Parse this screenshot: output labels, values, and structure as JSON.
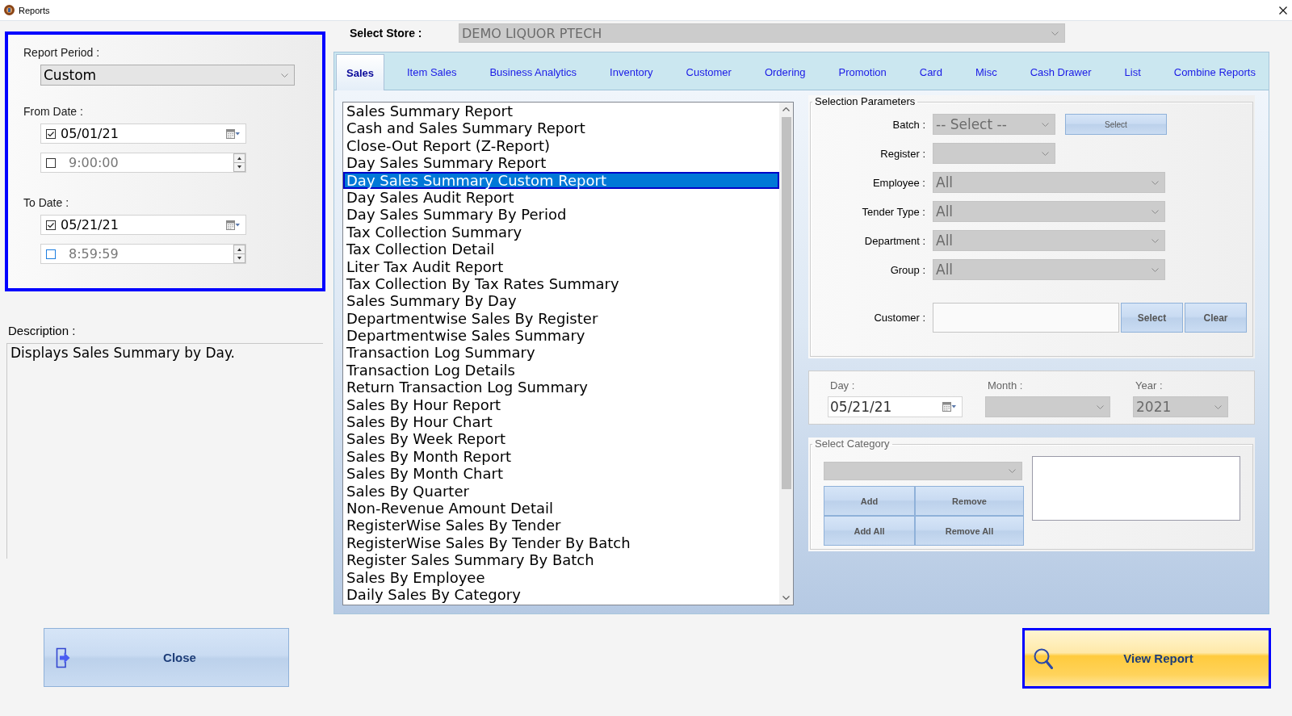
{
  "window": {
    "title": "Reports"
  },
  "period": {
    "label": "Report Period :",
    "dropdown": {
      "value": "Custom",
      "disabled": false
    },
    "ranges": [
      {
        "label": "From Date :",
        "date": {
          "value": "05/01/21",
          "checked": true,
          "focused": false
        },
        "time": {
          "value": "9:00:00",
          "checked": false,
          "focused": false
        }
      },
      {
        "label": "To Date :",
        "date": {
          "value": "05/21/21",
          "checked": true,
          "focused": false
        },
        "time": {
          "value": "8:59:59",
          "checked": false,
          "focused": true
        }
      }
    ]
  },
  "description": {
    "label": "Description :",
    "text": "Displays Sales Summary by Day."
  },
  "close_button": {
    "label": "Close"
  },
  "store": {
    "label": "Select Store :",
    "value": "DEMO LIQUOR PTECH",
    "disabled": true
  },
  "tabs": [
    {
      "label": "Sales",
      "selected": true
    },
    {
      "label": "Item Sales",
      "selected": false
    },
    {
      "label": "Business Analytics",
      "selected": false
    },
    {
      "label": "Inventory",
      "selected": false
    },
    {
      "label": "Customer",
      "selected": false
    },
    {
      "label": "Ordering",
      "selected": false
    },
    {
      "label": "Promotion",
      "selected": false
    },
    {
      "label": "Card",
      "selected": false
    },
    {
      "label": "Misc",
      "selected": false
    },
    {
      "label": "Cash Drawer",
      "selected": false
    },
    {
      "label": "List",
      "selected": false
    },
    {
      "label": "Combine Reports",
      "selected": false
    }
  ],
  "reports": [
    {
      "label": "Sales Summary Report",
      "selected": false
    },
    {
      "label": "Cash and Sales Summary Report",
      "selected": false
    },
    {
      "label": "Close-Out Report (Z-Report)",
      "selected": false
    },
    {
      "label": "Day Sales Summary Report",
      "selected": false
    },
    {
      "label": "Day Sales Summary Custom Report",
      "selected": true
    },
    {
      "label": "Day Sales Audit Report",
      "selected": false
    },
    {
      "label": "Day Sales Summary By Period",
      "selected": false
    },
    {
      "label": "Tax Collection Summary",
      "selected": false
    },
    {
      "label": "Tax Collection Detail",
      "selected": false
    },
    {
      "label": "Liter Tax Audit Report",
      "selected": false
    },
    {
      "label": "Tax Collection By Tax Rates Summary",
      "selected": false
    },
    {
      "label": "Sales Summary By Day",
      "selected": false
    },
    {
      "label": "Departmentwise Sales By Register",
      "selected": false
    },
    {
      "label": "Departmentwise Sales Summary",
      "selected": false
    },
    {
      "label": "Transaction Log Summary",
      "selected": false
    },
    {
      "label": "Transaction Log Details",
      "selected": false
    },
    {
      "label": "Return Transaction Log Summary",
      "selected": false
    },
    {
      "label": "Sales By Hour Report",
      "selected": false
    },
    {
      "label": "Sales By Hour Chart",
      "selected": false
    },
    {
      "label": "Sales By Week Report",
      "selected": false
    },
    {
      "label": "Sales By Month Report",
      "selected": false
    },
    {
      "label": "Sales By Month Chart",
      "selected": false
    },
    {
      "label": "Sales By Quarter",
      "selected": false
    },
    {
      "label": "Non-Revenue Amount Detail",
      "selected": false
    },
    {
      "label": "RegisterWise Sales By Tender",
      "selected": false
    },
    {
      "label": "RegisterWise Sales By Tender By Batch",
      "selected": false
    },
    {
      "label": "Register Sales Summary By Batch",
      "selected": false
    },
    {
      "label": "Sales By Employee",
      "selected": false
    },
    {
      "label": "Daily Sales By Category",
      "selected": false
    }
  ],
  "selection_parameters": {
    "title": "Selection Parameters",
    "fields": [
      {
        "kind": "short",
        "label": "Batch :",
        "value": "-- Select --",
        "disabled": true,
        "buttons": [
          "Select"
        ]
      },
      {
        "kind": "short",
        "label": "Register :",
        "disabled": true
      },
      {
        "kind": "long",
        "label": "Employee :",
        "value": "All",
        "disabled": true
      },
      {
        "kind": "long",
        "label": "Tender Type :",
        "value": "All",
        "disabled": true
      },
      {
        "kind": "long",
        "label": "Department :",
        "value": "All",
        "disabled": true
      },
      {
        "kind": "long",
        "label": "Group :",
        "value": "All",
        "disabled": true
      },
      {
        "kind": "text",
        "label": "Customer :",
        "disabled": false,
        "buttons": [
          "Select",
          "Clear"
        ]
      }
    ]
  },
  "period_picker": {
    "fields": [
      {
        "kind": "date",
        "label": "Day :",
        "value": "05/21/21"
      },
      {
        "kind": "dropdown",
        "label": "Month :",
        "disabled": true
      },
      {
        "kind": "dropdown",
        "label": "Year :",
        "value": "2021",
        "disabled": true
      }
    ]
  },
  "category": {
    "title": "Select Category",
    "dropdown": {
      "disabled": true
    },
    "buttons": [
      "Add",
      "Remove",
      "Add All",
      "Remove All"
    ]
  },
  "view_report_button": {
    "label": "View Report"
  }
}
